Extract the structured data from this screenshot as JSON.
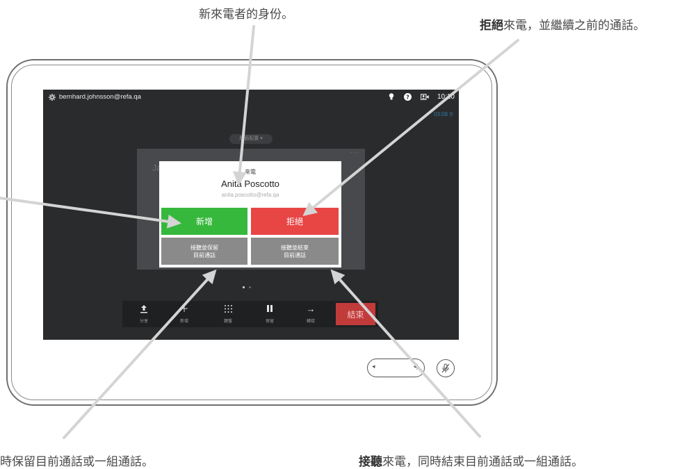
{
  "captions": {
    "top": "新來電者的身份。",
    "top_right_bold": "拒絕",
    "top_right_rest": "來電，並繼續之前的通話。",
    "bottom_left": "時保留目前通話或一組通話。",
    "bottom_right_bold": "接聽",
    "bottom_right_rest": "來電，同時結束目前通話或一組通話。"
  },
  "status_bar": {
    "user": "bernhard.johnsson@refa.qa",
    "time": "10:10",
    "call_timer": "03:08"
  },
  "layout_button": "版面配置",
  "background_participant_initial": "Ja",
  "incoming_call": {
    "title": "來電",
    "caller_name": "Anita Poscotto",
    "caller_email": "anita.poscotto@refa.qa",
    "accept_label": "新增",
    "decline_label": "拒絕",
    "hold_label": "接聽並保留\n目前通話",
    "end_current_label": "接聽並結束\n目前通話"
  },
  "toolbar": {
    "items": [
      {
        "label": "分享",
        "icon": "upload-icon"
      },
      {
        "label": "新增",
        "icon": "plus-icon"
      },
      {
        "label": "鍵盤",
        "icon": "keypad-icon"
      },
      {
        "label": "保留",
        "icon": "pause-icon"
      },
      {
        "label": "轉接",
        "icon": "arrow-right-icon"
      }
    ],
    "end_label": "結束"
  },
  "colors": {
    "accept": "#36b83c",
    "decline": "#e84545",
    "secondary": "#8a8a8a",
    "end": "#c23b3b",
    "screen_bg": "#2a2b2d",
    "arrow": "#d4d4d4"
  }
}
